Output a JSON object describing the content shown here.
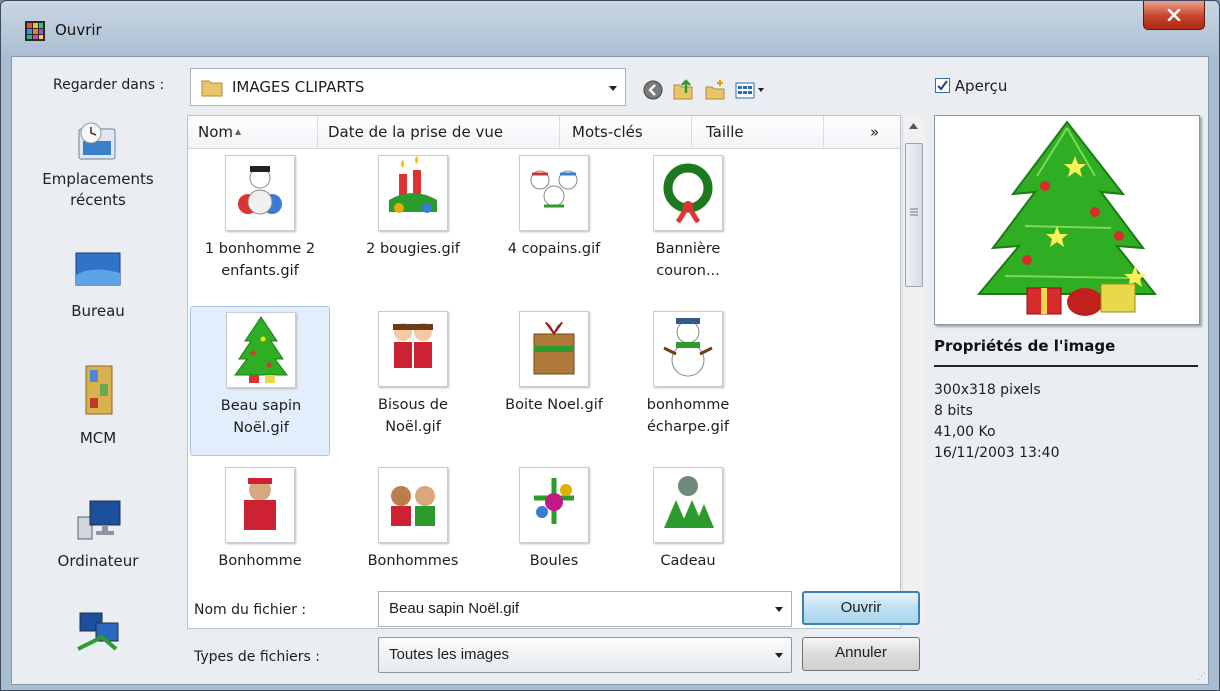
{
  "window": {
    "title": "Ouvrir"
  },
  "lookin": {
    "label": "Regarder dans :",
    "value": "IMAGES CLIPARTS"
  },
  "places": [
    {
      "label1": "Emplacements",
      "label2": "récents"
    },
    {
      "label1": "Bureau",
      "label2": ""
    },
    {
      "label1": "MCM",
      "label2": ""
    },
    {
      "label1": "Ordinateur",
      "label2": ""
    },
    {
      "label1": "",
      "label2": ""
    }
  ],
  "columns": [
    "Nom",
    "Date de la prise de vue",
    "Mots-clés",
    "Taille",
    "»"
  ],
  "files": [
    {
      "line1": "1 bonhomme 2",
      "line2": "enfants.gif",
      "thumb": "snowman-kids"
    },
    {
      "line1": "2 bougies.gif",
      "line2": "",
      "thumb": "candles"
    },
    {
      "line1": "4 copains.gif",
      "line2": "",
      "thumb": "friends"
    },
    {
      "line1": "Bannière",
      "line2": "couron...",
      "thumb": "wreath"
    },
    {
      "line1": "Beau sapin",
      "line2": "Noël.gif",
      "thumb": "tree"
    },
    {
      "line1": "Bisous de",
      "line2": "Noël.gif",
      "thumb": "kiss"
    },
    {
      "line1": "Boite Noel.gif",
      "line2": "",
      "thumb": "gift-box"
    },
    {
      "line1": "bonhomme",
      "line2": "écharpe.gif",
      "thumb": "snowman-scarf"
    },
    {
      "line1": "Bonhomme",
      "line2": "",
      "thumb": "bear"
    },
    {
      "line1": "Bonhommes",
      "line2": "",
      "thumb": "bears"
    },
    {
      "line1": "Boules",
      "line2": "",
      "thumb": "balls"
    },
    {
      "line1": "Cadeau",
      "line2": "",
      "thumb": "holly"
    }
  ],
  "preview": {
    "checkbox_label": "Aperçu",
    "checked": true
  },
  "properties": {
    "title": "Propriétés de l'image",
    "dimensions": "300x318 pixels",
    "depth": "8 bits",
    "size": "41,00 Ko",
    "date": "16/11/2003 13:40"
  },
  "filename": {
    "label": "Nom du fichier :",
    "value": "Beau sapin Noël.gif"
  },
  "filetype": {
    "label": "Types de fichiers :",
    "value": "Toutes les images"
  },
  "buttons": {
    "open": "Ouvrir",
    "cancel": "Annuler"
  }
}
